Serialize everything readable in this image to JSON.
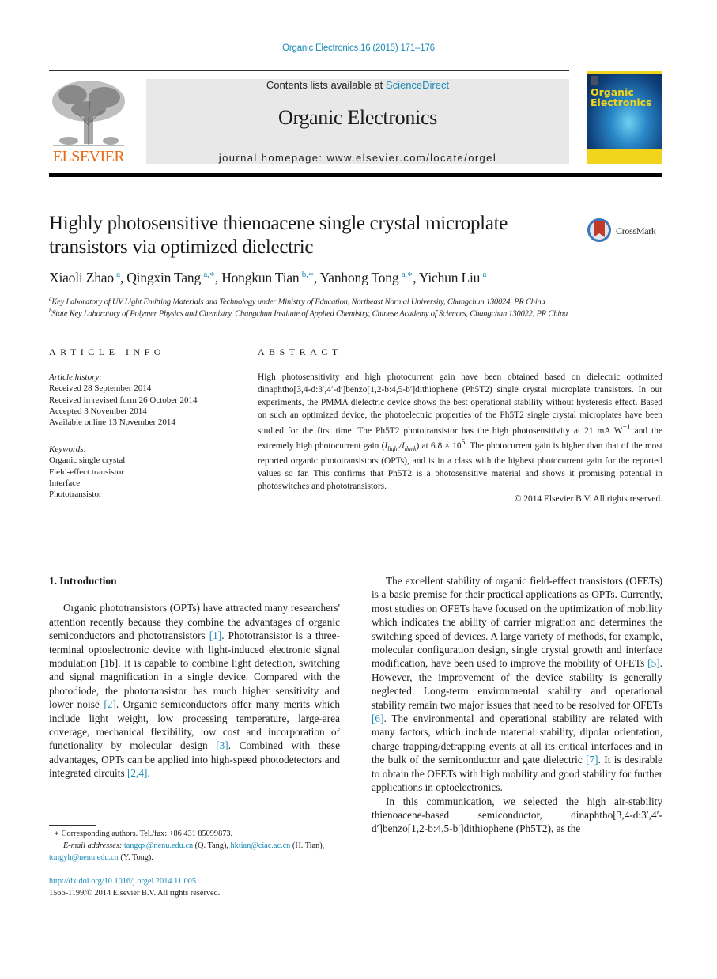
{
  "header": {
    "citation": "Organic Electronics 16 (2015) 171–176",
    "publisher_logo_text": "ELSEVIER",
    "contents_prefix": "Contents lists available at ",
    "contents_link": "ScienceDirect",
    "journal_title": "Organic Electronics",
    "homepage": "journal homepage: www.elsevier.com/locate/orgel",
    "cover_title_line1": "Organic",
    "cover_title_line2": "Electronics",
    "crossmark_label": "CrossMark"
  },
  "colors": {
    "link": "#1a8ab5",
    "elsevier_orange": "#e86a10",
    "masthead_bg": "#e8e8e8",
    "cover_yellow": "#f2d41c"
  },
  "article": {
    "title": "Highly photosensitive thienoacene single crystal microplate transistors via optimized dielectric",
    "authors": [
      {
        "name": "Xiaoli Zhao",
        "sup": "a"
      },
      {
        "name": "Qingxin Tang",
        "sup": "a,∗"
      },
      {
        "name": "Hongkun Tian",
        "sup": "b,∗"
      },
      {
        "name": "Yanhong Tong",
        "sup": "a,∗"
      },
      {
        "name": "Yichun Liu",
        "sup": "a"
      }
    ],
    "affiliations": [
      {
        "sup": "a",
        "text": "Key Laboratory of UV Light Emitting Materials and Technology under Ministry of Education, Northeast Normal University, Changchun 130024, PR China"
      },
      {
        "sup": "b",
        "text": "State Key Laboratory of Polymer Physics and Chemistry, Changchun Institute of Applied Chemistry, Chinese Academy of Sciences, Changchun 130022, PR China"
      }
    ]
  },
  "article_info": {
    "heading": "ARTICLE INFO",
    "history_label": "Article history:",
    "history": [
      "Received 28 September 2014",
      "Received in revised form 26 October 2014",
      "Accepted 3 November 2014",
      "Available online 13 November 2014"
    ],
    "keywords_label": "Keywords:",
    "keywords": [
      "Organic single crystal",
      "Field-effect transistor",
      "Interface",
      "Phototransistor"
    ]
  },
  "abstract": {
    "heading": "ABSTRACT",
    "part1": "High photosensitivity and high photocurrent gain have been obtained based on dielectric optimized dinaphtho[3,4-d:3′,4′-d′]benzo[1,2-b:4,5-b′]dithiophene (Ph5T2) single crystal microplate transistors. In our experiments, the PMMA dielectric device shows the best operational stability without hysteresis effect. Based on such an optimized device, the photoelectric properties of the Ph5T2 single crystal microplates have been studied for the first time. The Ph5T2 phototransistor has the high photosensitivity at 21 mA W",
    "sup1": "−1",
    "part2": " and the extremely high photocurrent gain (",
    "i_light": "I",
    "i_light_sub": "light",
    "slash": "/",
    "i_dark": "I",
    "i_dark_sub": "dark",
    "part3": ") at 6.8 × 10",
    "sup2": "5",
    "part4": ". The photocurrent gain is higher than that of the most reported organic phototransistors (OPTs), and is in a class with the highest photocurrent gain for the reported values so far. This confirms that Ph5T2 is a photosensitive material and shows it promising potential in photoswitches and phototransistors.",
    "copyright": "© 2014 Elsevier B.V. All rights reserved."
  },
  "body": {
    "section_heading": "1. Introduction",
    "left_para": {
      "t1": "Organic phototransistors (OPTs) have attracted many researchers' attention recently because they combine the advantages of organic semiconductors and phototransistors ",
      "r1": "[1]",
      "t2": ". Phototransistor is a three-terminal optoelectronic device with light-induced electronic signal modulation [1b]. It is capable to combine light detection, switching and signal magnification in a single device. Compared with the photodiode, the phototransistor has much higher sensitivity and lower noise ",
      "r2": "[2]",
      "t3": ". Organic semiconductors offer many merits which include light weight, low processing temperature, large-area coverage, mechanical flexibility, low cost and incorporation of functionality by molecular design ",
      "r3": "[3]",
      "t4": ". Combined with these advantages, OPTs can be applied into high-speed photodetectors and integrated circuits ",
      "r4": "[2,4]",
      "t5": "."
    },
    "right_para1": {
      "t1": "The excellent stability of organic field-effect transistors (OFETs) is a basic premise for their practical applications as OPTs. Currently, most studies on OFETs have focused on the optimization of mobility which indicates the ability of carrier migration and determines the switching speed of devices. A large variety of methods, for example, molecular configuration design, single crystal growth and interface modification, have been used to improve the mobility of OFETs ",
      "r1": "[5]",
      "t2": ". However, the improvement of the device stability is generally neglected. Long-term environmental stability and operational stability remain two major issues that need to be resolved for OFETs ",
      "r2": "[6]",
      "t3": ". The environmental and operational stability are related with many factors, which include material stability, dipolar orientation, charge trapping/detrapping events at all its critical interfaces and in the bulk of the semiconductor and gate dielectric ",
      "r3": "[7]",
      "t4": ". It is desirable to obtain the OFETs with high mobility and good stability for further applications in optoelectronics."
    },
    "right_para2": "In this communication, we selected the high air-stability thienoacene-based semiconductor, dinaphtho[3,4-d:3′,4′-d′]benzo[1,2-b:4,5-b′]dithiophene (Ph5T2), as the"
  },
  "footnote": {
    "corresponding": "∗ Corresponding authors. Tel./fax: +86 431 85099873.",
    "email_label": "E-mail addresses:",
    "emails": [
      {
        "addr": "tangqx@nenu.edu.cn",
        "who": " (Q. Tang), "
      },
      {
        "addr": "hktian@ciac.ac.cn",
        "who": " (H. Tian), "
      },
      {
        "addr": "tongyh@nenu.edu.cn",
        "who": " (Y. Tong)."
      }
    ],
    "doi": "http://dx.doi.org/10.1016/j.orgel.2014.11.005",
    "issn": "1566-1199/© 2014 Elsevier B.V. All rights reserved."
  }
}
